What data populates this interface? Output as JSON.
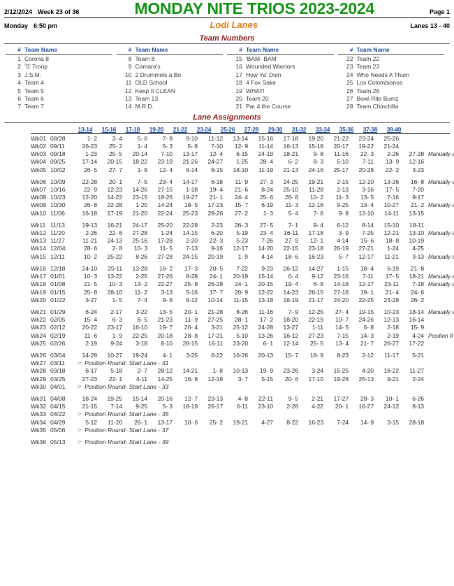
{
  "header": {
    "date": "2/12/2024",
    "week_of": "Week 23 of 36",
    "title": "MONDAY NITE TRIOS 2023-2024",
    "page": "Page 1",
    "day": "Monday",
    "time": "6:50 pm",
    "venue": "Lodi Lanes",
    "lanes": "Lanes 13 - 40",
    "title_color": "#149414",
    "venue_color": "#E07B16"
  },
  "team_numbers": {
    "section_title": "Team Numbers",
    "col_head_num": "#",
    "col_head_name": "Team Name",
    "columns": [
      [
        {
          "num": "1",
          "name": "Corona 8"
        },
        {
          "num": "2",
          "name": "'S' Troop"
        },
        {
          "num": "3",
          "name": "J.S.M."
        },
        {
          "num": "4",
          "name": "Team 4"
        },
        {
          "num": "5",
          "name": "Team 5"
        },
        {
          "num": "6",
          "name": "Team 6"
        },
        {
          "num": "7",
          "name": "Team 7"
        }
      ],
      [
        {
          "num": "8",
          "name": "Team 8"
        },
        {
          "num": "9",
          "name": "Camara's"
        },
        {
          "num": "10",
          "name": "2 Drummels  a Bo"
        },
        {
          "num": "11",
          "name": "OLD School"
        },
        {
          "num": "12",
          "name": "Keep It CLEAN"
        },
        {
          "num": "13",
          "name": "Team 13"
        },
        {
          "num": "14",
          "name": "M.R.D."
        }
      ],
      [
        {
          "num": "15",
          "name": "'BAM- BAM'"
        },
        {
          "num": "16",
          "name": "Wounded Warriors"
        },
        {
          "num": "17",
          "name": "How Ya' Doin"
        },
        {
          "num": "18",
          "name": "4 Fox Sake"
        },
        {
          "num": "19",
          "name": "WHAT!"
        },
        {
          "num": "20",
          "name": "Team 20"
        },
        {
          "num": "21",
          "name": "Par 4 the Course"
        }
      ],
      [
        {
          "num": "22",
          "name": "Team 22"
        },
        {
          "num": "23",
          "name": "Team 23"
        },
        {
          "num": "24",
          "name": "Who Needs A Thum"
        },
        {
          "num": "25",
          "name": "Los Colombianos"
        },
        {
          "num": "26",
          "name": "Team 26"
        },
        {
          "num": "27",
          "name": "Bowl Rite Bumz"
        },
        {
          "num": "28",
          "name": "Team Chinchilla"
        }
      ]
    ]
  },
  "lane_assignments": {
    "section_title": "Lane Assignments",
    "lane_pairs": [
      "13-14",
      "15-16",
      "17-18",
      "19-20",
      "21-22",
      "23-24",
      "25-26",
      "27-28",
      "29-30",
      "31-32",
      "33-34",
      "35-36",
      "37-38",
      "39-40"
    ],
    "hand_icon": "☞",
    "note_manual": "Manually assigned",
    "weeks": [
      {
        "wk": "Wk01",
        "date": "08/28",
        "matches": [
          "1- 2",
          "3- 4",
          "5- 6",
          "7- 8",
          "9-10",
          "11-12",
          "13-14",
          "15-16",
          "17-18",
          "19-20",
          "21-22",
          "23-24",
          "25-26",
          ""
        ],
        "note": "",
        "gap_after": false
      },
      {
        "wk": "Wk02",
        "date": "09/11",
        "matches": [
          "26-23",
          "25- 2",
          "1- 4",
          "6- 3",
          "5- 8",
          "7-10",
          "12- 9",
          "11-14",
          "16-13",
          "15-18",
          "20-17",
          "19-22",
          "21-24",
          ""
        ],
        "note": "",
        "gap_after": false
      },
      {
        "wk": "Wk03",
        "date": "09/18",
        "matches": [
          "1-23",
          "25- 5",
          "20-14",
          "7-10",
          "13-17",
          "12- 4",
          "6-15",
          "24-19",
          "18-21",
          "9- 8",
          "11-16",
          "22- 3",
          "2-26",
          "27-28"
        ],
        "note": "Manually assigned",
        "gap_after": false
      },
      {
        "wk": "Wk04",
        "date": "09/25",
        "matches": [
          "17-14",
          "20-15",
          "18-22",
          "23-19",
          "21-26",
          "24-27",
          "1-25",
          "28- 4",
          "6- 2",
          "8- 3",
          "5-10",
          "7-11",
          "13- 9",
          "12-16"
        ],
        "note": "",
        "gap_after": false
      },
      {
        "wk": "Wk05",
        "date": "10/02",
        "matches": [
          "26- 5",
          "27- 7",
          "1- 9",
          "12- 4",
          "6-14",
          "8-15",
          "18-10",
          "11-19",
          "21-13",
          "24-16",
          "25-17",
          "20-28",
          "22- 2",
          "3-23"
        ],
        "note": "",
        "gap_after": true
      },
      {
        "wk": "Wk06",
        "date": "10/09",
        "matches": [
          "22-28",
          "20- 1",
          "7- 5",
          "23- 4",
          "14-17",
          "6-18",
          "11- 9",
          "27- 3",
          "24-25",
          "19-21",
          "2-15",
          "12-10",
          "13-26",
          "16- 8"
        ],
        "note": "Manually assigned",
        "gap_after": false
      },
      {
        "wk": "Wk07",
        "date": "10/16",
        "matches": [
          "22- 9",
          "12-23",
          "14-26",
          "27-15",
          "1-18",
          "19- 4",
          "21- 6",
          "8-24",
          "25-10",
          "11-28",
          "2-13",
          "3-16",
          "17- 5",
          "7-20"
        ],
        "note": "",
        "gap_after": false
      },
      {
        "wk": "Wk08",
        "date": "10/23",
        "matches": [
          "12-20",
          "14-22",
          "23-15",
          "18-26",
          "19-27",
          "21- 1",
          "24- 4",
          "25- 6",
          "28- 8",
          "10- 2",
          "11- 3",
          "13- 5",
          "7-16",
          "9-17"
        ],
        "note": "",
        "gap_after": false
      },
      {
        "wk": "Wk09",
        "date": "10/30",
        "matches": [
          "26- 8",
          "22-28",
          "1-20",
          "14-24",
          "18- 5",
          "17-23",
          "15- 7",
          "6-19",
          "11- 3",
          "12-16",
          "9-25",
          "13- 4",
          "10-27",
          "21- 2"
        ],
        "note": "Manually assigned",
        "gap_after": false
      },
      {
        "wk": "Wk10",
        "date": "11/06",
        "matches": [
          "16-18",
          "17-19",
          "21-20",
          "22-24",
          "25-23",
          "28-26",
          "27- 2",
          "1- 3",
          "5- 4",
          "7- 6",
          "9- 8",
          "12-10",
          "14-11",
          "13-15"
        ],
        "note": "",
        "gap_after": true
      },
      {
        "wk": "Wk11",
        "date": "11/13",
        "matches": [
          "19-13",
          "16-21",
          "24-17",
          "25-20",
          "22-28",
          "2-23",
          "26- 3",
          "27- 5",
          "7- 1",
          "9- 4",
          "6-12",
          "8-14",
          "15-10",
          "18-11"
        ],
        "note": "",
        "gap_after": false
      },
      {
        "wk": "Wk12",
        "date": "11/20",
        "matches": [
          "2-26",
          "22- 8",
          "27-28",
          "1-24",
          "14-15",
          "6-20",
          "5-19",
          "23- 4",
          "16-11",
          "17-18",
          "3- 9",
          "7-25",
          "12-21",
          "13-10"
        ],
        "note": "Manually assigned",
        "gap_after": false
      },
      {
        "wk": "Wk13",
        "date": "11/27",
        "matches": [
          "11-21",
          "24-13",
          "25-16",
          "17-28",
          "2-20",
          "22- 3",
          "5-23",
          "7-26",
          "27- 9",
          "12- 1",
          "4-14",
          "15- 6",
          "18- 8",
          "10-19"
        ],
        "note": "",
        "gap_after": false
      },
      {
        "wk": "Wk14",
        "date": "12/04",
        "matches": [
          "28- 6",
          "2- 8",
          "10- 3",
          "11- 5",
          "7-13",
          "9-16",
          "12-17",
          "14-20",
          "22-15",
          "23-18",
          "26-19",
          "27-21",
          "1-24",
          "4-25"
        ],
        "note": "",
        "gap_after": false
      },
      {
        "wk": "Wk15",
        "date": "12/11",
        "matches": [
          "10- 2",
          "25-22",
          "8-26",
          "27-28",
          "24-15",
          "20-19",
          "1- 9",
          "4-14",
          "18- 6",
          "16-23",
          "5- 7",
          "12-17",
          "11-21",
          "3-13"
        ],
        "note": "Manually assigned",
        "gap_after": true
      },
      {
        "wk": "Wk16",
        "date": "12/18",
        "matches": [
          "24-10",
          "25-11",
          "13-28",
          "16- 2",
          "17- 3",
          "20- 5",
          "7-22",
          "9-23",
          "26-12",
          "14-27",
          "1-15",
          "18- 4",
          "6-19",
          "21- 8"
        ],
        "note": "",
        "gap_after": false
      },
      {
        "wk": "Wk17",
        "date": "01/01",
        "matches": [
          "10- 3",
          "13-22",
          "2-25",
          "27-26",
          "8-28",
          "24- 1",
          "20-19",
          "15-14",
          "6- 4",
          "9-12",
          "23-16",
          "7-11",
          "17- 5",
          "18-21"
        ],
        "note": "Manually assigned",
        "gap_after": false
      },
      {
        "wk": "Wk18",
        "date": "01/08",
        "matches": [
          "21- 5",
          "10- 3",
          "13- 2",
          "22-27",
          "25- 8",
          "26-28",
          "24- 1",
          "20-15",
          "19- 4",
          "6- 9",
          "14-16",
          "12-17",
          "23-11",
          "7-18"
        ],
        "note": "Manually assigned",
        "gap_after": false
      },
      {
        "wk": "Wk19",
        "date": "01/15",
        "matches": [
          "25- 8",
          "28-10",
          "11- 2",
          "3-13",
          "5-16",
          "17- 7",
          "20- 9",
          "12-22",
          "14-23",
          "26-15",
          "27-18",
          "19- 1",
          "21- 4",
          "24- 6"
        ],
        "note": "",
        "gap_after": false
      },
      {
        "wk": "Wk20",
        "date": "01/22",
        "matches": [
          "3-27",
          "1- 5",
          "7- 4",
          "9- 6",
          "8-12",
          "10-14",
          "11-15",
          "13-18",
          "16-19",
          "21-17",
          "24-20",
          "22-25",
          "23-28",
          "26- 2"
        ],
        "note": "",
        "gap_after": true
      },
      {
        "wk": "Wk21",
        "date": "01/29",
        "matches": [
          "6-24",
          "2-17",
          "3-22",
          "13- 5",
          "20- 1",
          "21-28",
          "8-26",
          "11-16",
          "7- 9",
          "12-25",
          "27- 4",
          "19-15",
          "10-23",
          "18-14"
        ],
        "note": "Manually assigned",
        "gap_after": false
      },
      {
        "wk": "Wk22",
        "date": "02/05",
        "matches": [
          "15- 4",
          "6- 3",
          "8- 5",
          "21-23",
          "11- 9",
          "27-25",
          "28- 1",
          "17- 2",
          "18-20",
          "22-19",
          "10- 7",
          "24-26",
          "12-13",
          "16-14"
        ],
        "note": "",
        "gap_after": false
      },
      {
        "wk": "Wk23",
        "date": "02/12",
        "matches": [
          "20-22",
          "23-17",
          "16-10",
          "19- 7",
          "26- 4",
          "3-21",
          "25-12",
          "24-28",
          "13-27",
          "1-11",
          "14- 5",
          "6- 8",
          "2-18",
          "15- 9"
        ],
        "note": "",
        "gap_after": false
      },
      {
        "wk": "Wk24",
        "date": "02/19",
        "matches": [
          "11- 6",
          "1- 9",
          "22-25",
          "20-18",
          "28- 8",
          "17-21",
          "5-10",
          "13-26",
          "16-12",
          "27-23",
          "7-15",
          "14- 3",
          "2-19",
          "4-24"
        ],
        "note": "Position Round- Start La",
        "gap_after": false
      },
      {
        "wk": "Wk25",
        "date": "02/26",
        "matches": [
          "2-19",
          "9-24",
          "3-18",
          "8-10",
          "28-15",
          "16-11",
          "23-20",
          "6- 1",
          "12-14",
          "25- 5",
          "13- 4",
          "21- 7",
          "26-27",
          "17-22"
        ],
        "note": "",
        "gap_after": true
      },
      {
        "wk": "Wk26",
        "date": "03/04",
        "matches": [
          "14-28",
          "10-27",
          "19-24",
          "4- 1",
          "3-25",
          "6-22",
          "16-26",
          "20-13",
          "15- 7",
          "18- 9",
          "8-23",
          "2-12",
          "11-17",
          "5-21"
        ],
        "note": "",
        "gap_after": false
      },
      {
        "wk": "Wk27",
        "date": "03/11",
        "matches": [],
        "position_note": "Position Round- Start Lane - 31",
        "gap_after": false
      },
      {
        "wk": "Wk28",
        "date": "03/18",
        "matches": [
          "6-17",
          "5-18",
          "2- 7",
          "28-12",
          "14-21",
          "1- 8",
          "10-13",
          "19- 9",
          "23-26",
          "3-24",
          "15-25",
          "4-20",
          "16-22",
          "11-27"
        ],
        "note": "",
        "gap_after": false
      },
      {
        "wk": "Wk29",
        "date": "03/25",
        "matches": [
          "27-23",
          "22- 1",
          "4-11",
          "14-25",
          "16- 8",
          "12-18",
          "3- 7",
          "5-15",
          "20- 6",
          "17-10",
          "19-28",
          "26-13",
          "9-21",
          "2-24"
        ],
        "note": "",
        "gap_after": false
      },
      {
        "wk": "Wk30",
        "date": "04/01",
        "matches": [],
        "position_note": "Position Round- Start Lane - 33",
        "gap_after": true
      },
      {
        "wk": "Wk31",
        "date": "04/08",
        "matches": [
          "18-24",
          "19-25",
          "15-14",
          "20-16",
          "12- 7",
          "23-13",
          "4- 8",
          "22-11",
          "9- 5",
          "2-21",
          "17-27",
          "28- 3",
          "10- 1",
          "6-26"
        ],
        "note": "",
        "gap_after": false
      },
      {
        "wk": "Wk32",
        "date": "04/15",
        "matches": [
          "21-15",
          "7-14",
          "9-25",
          "5- 3",
          "18-19",
          "26-17",
          "6-11",
          "23-10",
          "2-28",
          "4-22",
          "20- 1",
          "16-27",
          "24-12",
          "8-13"
        ],
        "note": "",
        "gap_after": false
      },
      {
        "wk": "Wk33",
        "date": "04/22",
        "matches": [],
        "position_note": "Position Round- Start Lane - 35",
        "gap_after": false
      },
      {
        "wk": "Wk34",
        "date": "04/29",
        "matches": [
          "5-12",
          "11-20",
          "26- 1",
          "13-17",
          "10- 6",
          "25- 2",
          "19-21",
          "4-27",
          "8-22",
          "16-23",
          "7-24",
          "14- 9",
          "3-15",
          "28-18"
        ],
        "note": "",
        "gap_after": false
      },
      {
        "wk": "Wk35",
        "date": "05/06",
        "matches": [],
        "position_note": "Position Round- Start Lane - 37",
        "gap_after": true
      },
      {
        "wk": "Wk36",
        "date": "05/13",
        "matches": [],
        "position_note": "Position Round- Start Lane - 39",
        "gap_after": false
      }
    ]
  }
}
